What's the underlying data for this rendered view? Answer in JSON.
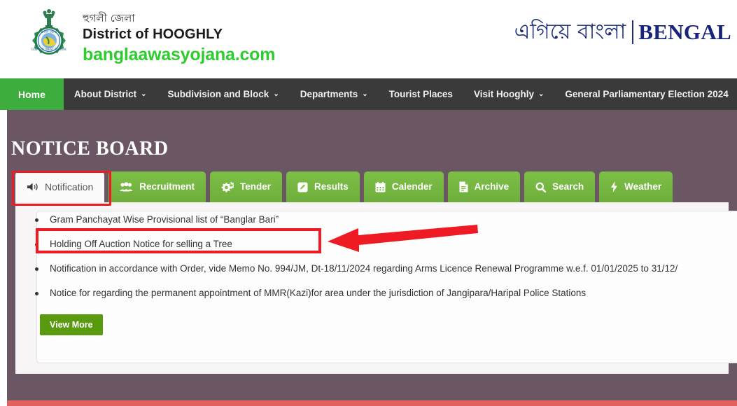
{
  "header": {
    "emblem_icon": "hooghly-district-emblem",
    "brand_bengali": "হুগলী জেলা",
    "brand_english": "District of HOOGHLY",
    "brand_site": "banglaawasyojana.com",
    "bengal_logo_bengali": "এগিয়ে বাংলা",
    "bengal_logo_english": "BENGAL"
  },
  "nav": {
    "items": [
      {
        "label": "Home",
        "caret": false,
        "active": true
      },
      {
        "label": "About District",
        "caret": true,
        "active": false
      },
      {
        "label": "Subdivision and Block",
        "caret": true,
        "active": false
      },
      {
        "label": "Departments",
        "caret": true,
        "active": false
      },
      {
        "label": "Tourist Places",
        "caret": false,
        "active": false
      },
      {
        "label": "Visit Hooghly",
        "caret": true,
        "active": false
      },
      {
        "label": "General Parliamentary Election 2024",
        "caret": false,
        "active": false
      }
    ],
    "caret_glyph": "⌄"
  },
  "notice_board": {
    "title": "NOTICE BOARD",
    "tabs": [
      {
        "label": "Notification",
        "icon": "speaker-icon",
        "active": true
      },
      {
        "label": "Recruitment",
        "icon": "users-icon",
        "active": false
      },
      {
        "label": "Tender",
        "icon": "cogs-icon",
        "active": false
      },
      {
        "label": "Results",
        "icon": "edit-square-icon",
        "active": false
      },
      {
        "label": "Calender",
        "icon": "calendar-icon",
        "active": false
      },
      {
        "label": "Archive",
        "icon": "file-icon",
        "active": false
      },
      {
        "label": "Search",
        "icon": "search-icon",
        "active": false
      },
      {
        "label": "Weather",
        "icon": "bolt-icon",
        "active": false
      }
    ],
    "notices": [
      "Gram Panchayat Wise Provisional list of “Banglar Bari”",
      "Holding Off Auction Notice for selling a Tree",
      "Notification in accordance with Order, vide Memo No. 994/JM, Dt-18/11/2024 regarding Arms Licence Renewal Programme w.e.f. 01/01/2025 to 31/12/",
      "Notice for regarding the permanent appointment of MMR(Kazi)for area under the jurisdiction of Jangipara/Haripal Police Stations"
    ],
    "view_more_label": "View More"
  },
  "annotations": {
    "highlight_color": "#ee1b24",
    "tab_highlight_target": "Notification",
    "notice_highlight_target": "Gram Panchayat Wise Provisional list of “Banglar Bari”",
    "arrow_direction": "left"
  },
  "colors": {
    "nav_background": "#3a3a3a",
    "nav_active": "#3dad3d",
    "panel_background": "#6b5764",
    "tab_green": "#7cbf46",
    "button_green": "#5a9a0f",
    "site_green": "#2ecc2e",
    "bengal_navy": "#17247a",
    "bottom_strip": "#e0615e"
  }
}
